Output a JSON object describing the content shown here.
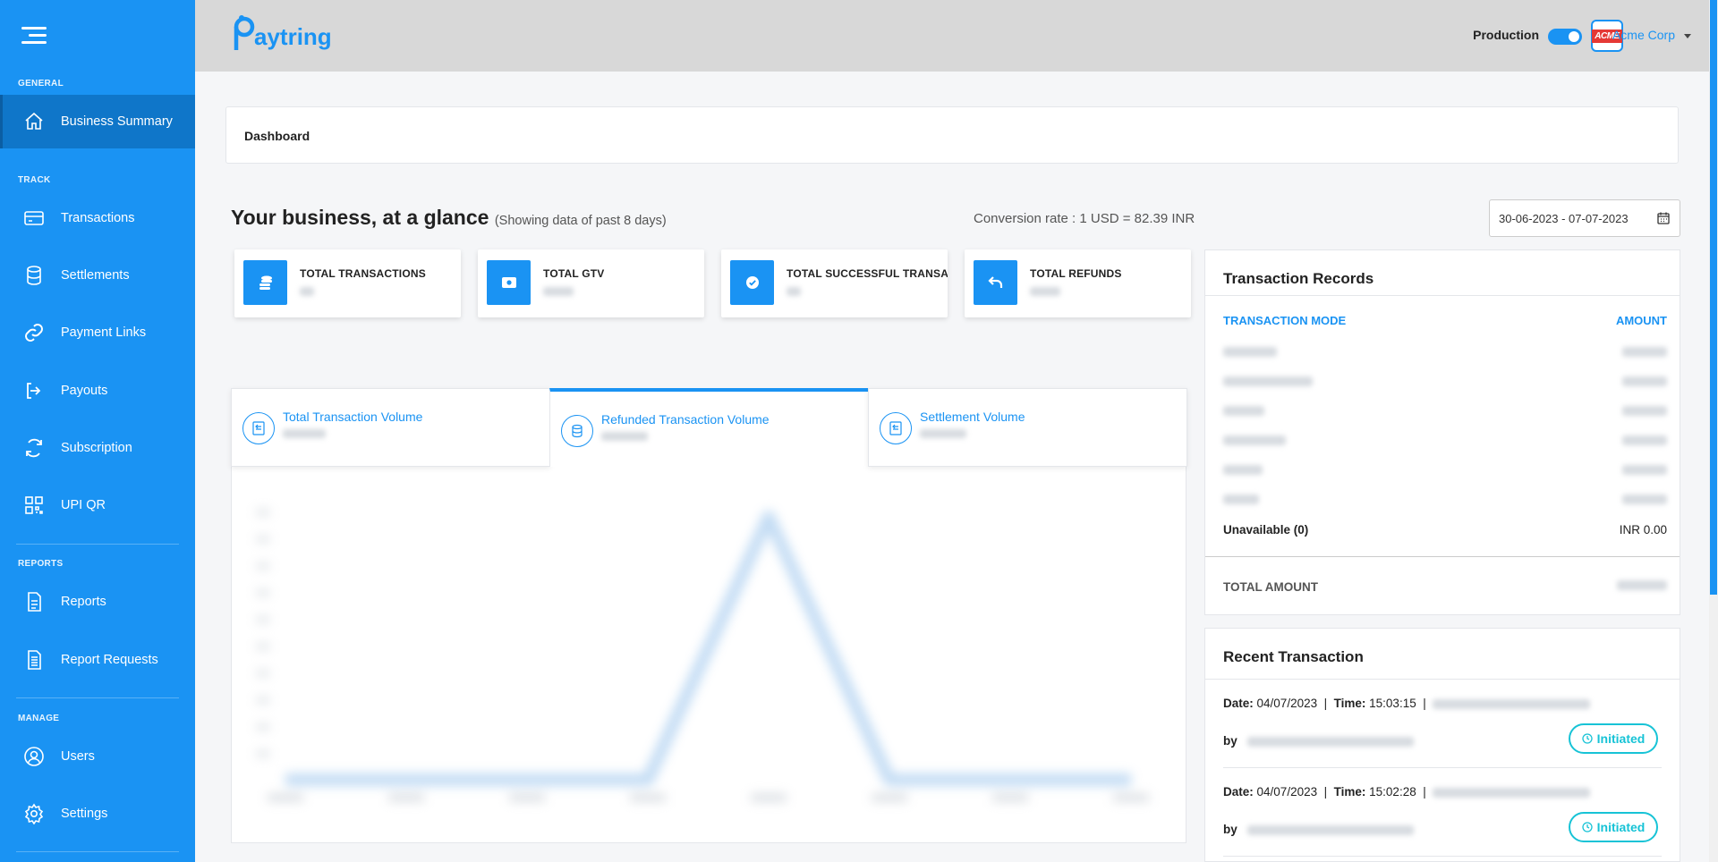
{
  "brand": {
    "name": "Paytring",
    "logo_rest": "aytring",
    "accent": "#1a93f3"
  },
  "sidebar": {
    "sections": {
      "general": "GENERAL",
      "track": "TRACK",
      "reports": "REPORTS",
      "manage": "MANAGE"
    },
    "items": [
      {
        "label": "Business Summary",
        "icon": "home-icon",
        "active": true
      },
      {
        "label": "Transactions",
        "icon": "card-icon"
      },
      {
        "label": "Settlements",
        "icon": "database-icon"
      },
      {
        "label": "Payment Links",
        "icon": "link-icon"
      },
      {
        "label": "Payouts",
        "icon": "sign-out-icon"
      },
      {
        "label": "Subscription",
        "icon": "refresh-icon"
      },
      {
        "label": "UPI QR",
        "icon": "qr-icon"
      },
      {
        "label": "Reports",
        "icon": "document-icon"
      },
      {
        "label": "Report Requests",
        "icon": "document-list-icon"
      },
      {
        "label": "Users",
        "icon": "user-circle-icon"
      },
      {
        "label": "Settings",
        "icon": "gear-icon"
      }
    ]
  },
  "header": {
    "env_label": "Production",
    "env_on": true,
    "company": "Acme Corp",
    "avatar_text": "ACME"
  },
  "breadcrumb": "Dashboard",
  "glance": {
    "title": "Your business, at a glance",
    "subtitle": "(Showing data of past 8 days)",
    "conversion": "Conversion rate : 1 USD = 82.39 INR",
    "date_range": "30-06-2023 - 07-07-2023"
  },
  "stats": [
    {
      "label": "TOTAL TRANSACTIONS",
      "icon": "coins-icon"
    },
    {
      "label": "TOTAL GTV",
      "icon": "cash-icon"
    },
    {
      "label": "TOTAL SUCCESSFUL TRANSACTIONS",
      "icon": "check-icon"
    },
    {
      "label": "TOTAL REFUNDS",
      "icon": "undo-icon"
    }
  ],
  "volume_tabs": [
    {
      "label": "Total Transaction Volume",
      "active": false
    },
    {
      "label": "Refunded Transaction Volume",
      "active": true
    },
    {
      "label": "Settlement Volume",
      "active": false
    }
  ],
  "records": {
    "title": "Transaction Records",
    "col_mode": "TRANSACTION MODE",
    "col_amount": "AMOUNT",
    "unavailable_label": "Unavailable (0)",
    "unavailable_amount": "INR 0.00",
    "total_label": "TOTAL AMOUNT"
  },
  "recent": {
    "title": "Recent Transaction",
    "date_label": "Date:",
    "time_label": "Time:",
    "by_label": "by",
    "items": [
      {
        "date": "04/07/2023",
        "time": "15:03:15",
        "status": "Initiated"
      },
      {
        "date": "04/07/2023",
        "time": "15:02:28",
        "status": "Initiated"
      }
    ]
  }
}
